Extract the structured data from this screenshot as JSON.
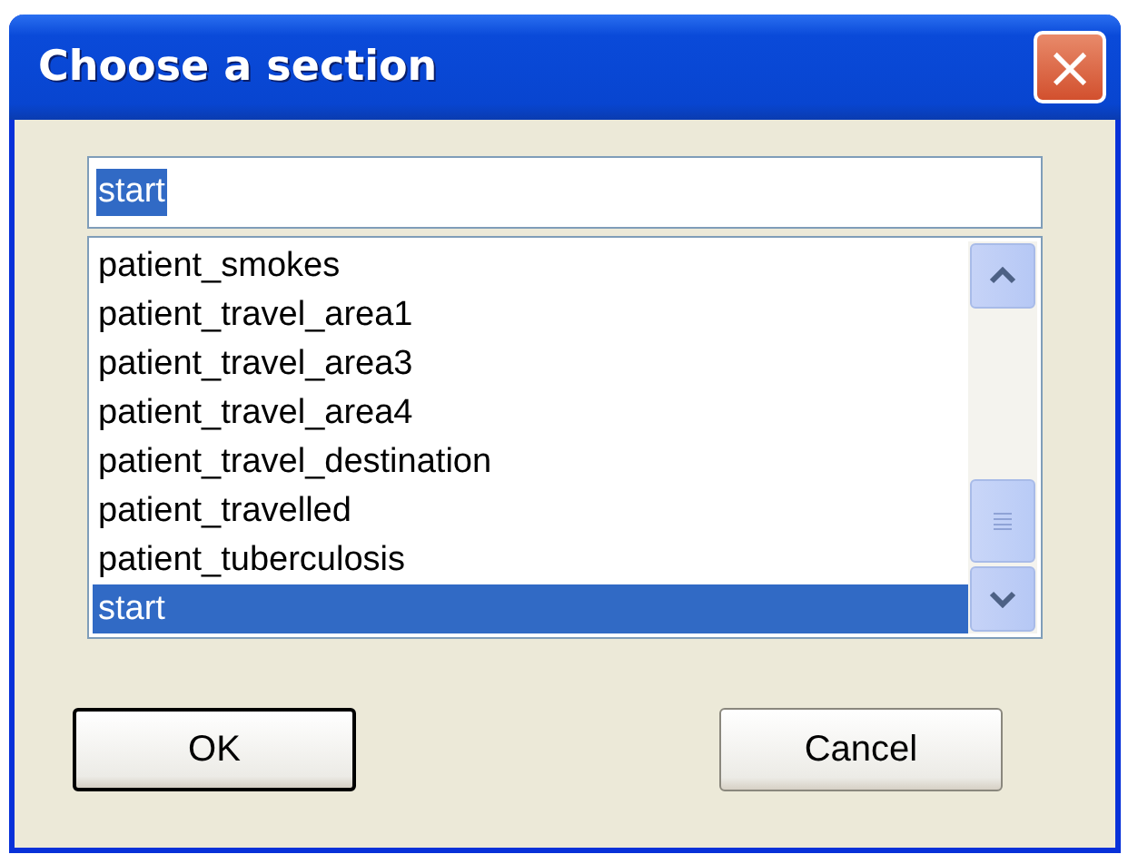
{
  "window": {
    "title": "Choose a section",
    "close": "×"
  },
  "search": {
    "value": "start",
    "text_selected": true
  },
  "list": {
    "items": [
      {
        "label": "patient_smokes",
        "selected": false
      },
      {
        "label": "patient_travel_area1",
        "selected": false
      },
      {
        "label": "patient_travel_area3",
        "selected": false
      },
      {
        "label": "patient_travel_area4",
        "selected": false
      },
      {
        "label": "patient_travel_destination",
        "selected": false
      },
      {
        "label": "patient_travelled",
        "selected": false
      },
      {
        "label": "patient_tuberculosis",
        "selected": false
      },
      {
        "label": "start",
        "selected": true
      }
    ]
  },
  "buttons": [
    {
      "label": "OK",
      "default": true
    },
    {
      "label": "Cancel",
      "default": false
    }
  ]
}
